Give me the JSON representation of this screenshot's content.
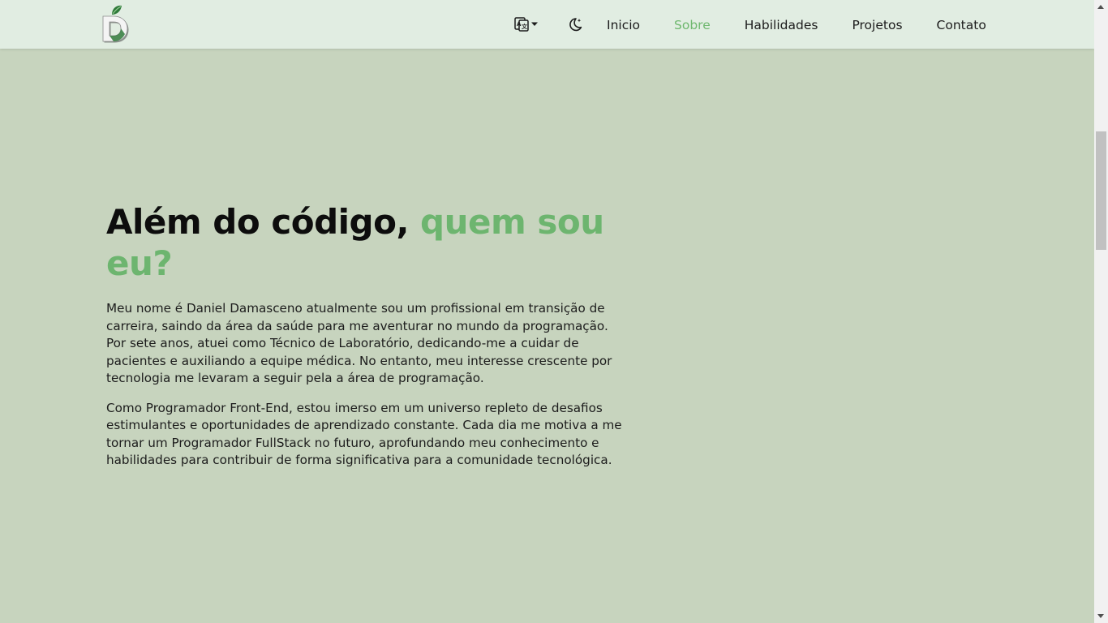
{
  "header": {
    "logo_letter": "D",
    "language_icon": "translate-icon",
    "theme_icon": "moon-icon",
    "nav": [
      {
        "label": "Inicio",
        "active": false
      },
      {
        "label": "Sobre",
        "active": true
      },
      {
        "label": "Habilidades",
        "active": false
      },
      {
        "label": "Projetos",
        "active": false
      },
      {
        "label": "Contato",
        "active": false
      }
    ]
  },
  "about": {
    "title_part1": "Além do código, ",
    "title_accent": "quem sou eu?",
    "paragraph1": "Meu nome é Daniel Damasceno atualmente sou um profissional em transição de carreira, saindo da área da saúde para me aventurar no mundo da programação. Por sete anos, atuei como Técnico de Laboratório, dedicando-me a cuidar de pacientes e auxiliando a equipe médica. No entanto, meu interesse crescente por tecnologia me levaram a seguir pela a área de programação.",
    "paragraph2": "Como Programador Front-End, estou imerso em um universo repleto de desafios estimulantes e oportunidades de aprendizado constante. Cada dia me motiva a me tornar um Programador FullStack no futuro, aprofundando meu conhecimento e habilidades para contribuir de forma significativa para a comunidade tecnológica."
  },
  "colors": {
    "background": "#c7d4be",
    "navbar": "#e1ede2",
    "accent": "#6db56f",
    "text": "#1c1c1c"
  }
}
